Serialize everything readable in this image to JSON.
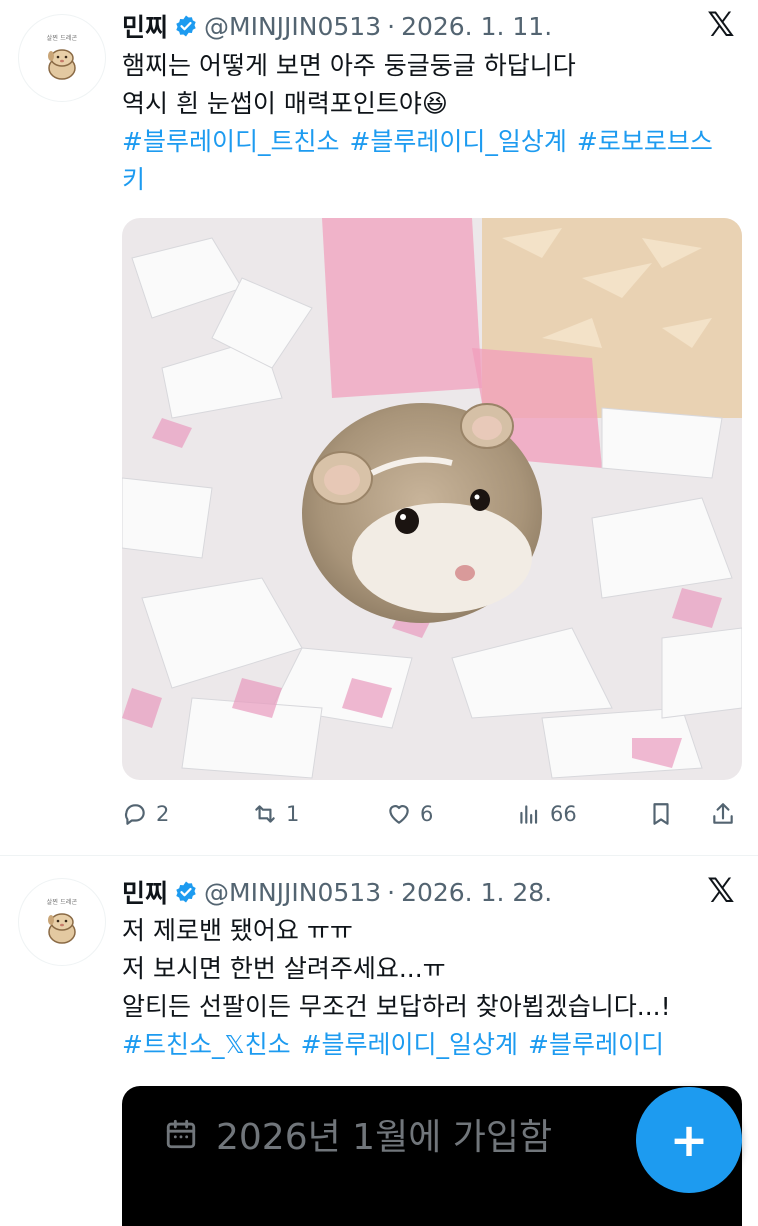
{
  "tweets": [
    {
      "name": "민찌",
      "handle": "@MINJJIN0513",
      "separator": "·",
      "date": "2026. 1. 11.",
      "avatar_caption": "살찐 드레곤",
      "lines": [
        "햄찌는 어떻게 보면 아주 둥글둥글 하답니다",
        "역시 흰 눈썹이 매력포인트야😆"
      ],
      "hashtags": [
        "#블루레이디_트친소",
        "#블루레이디_일상계",
        "#로보로브스키"
      ],
      "actions": {
        "replies": "2",
        "reposts": "1",
        "likes": "6",
        "views": "66"
      }
    },
    {
      "name": "민찌",
      "handle": "@MINJJIN0513",
      "separator": "·",
      "date": "2026. 1. 28.",
      "avatar_caption": "살찐 드레곤",
      "lines": [
        "저 제로밴 됐어요 ㅠㅠ",
        "저 보시면 한번 살려주세요...ㅠ",
        "알티든 선팔이든 무조건 보답하러 찾아뵙겠습니다...!"
      ],
      "hashtags": [
        "#트친소_𝕏친소",
        "#블루레이디_일상계",
        "#블루레이디"
      ],
      "card_text": "2026년 1월에 가입함"
    }
  ],
  "fab_label": "+",
  "colors": {
    "accent": "#1d9bf0",
    "muted": "#536471",
    "text": "#0f1419"
  },
  "icons": [
    "verified-badge-icon",
    "x-logo-icon",
    "reply-icon",
    "repost-icon",
    "like-icon",
    "views-icon",
    "bookmark-icon",
    "share-icon",
    "calendar-icon",
    "plus-icon"
  ]
}
